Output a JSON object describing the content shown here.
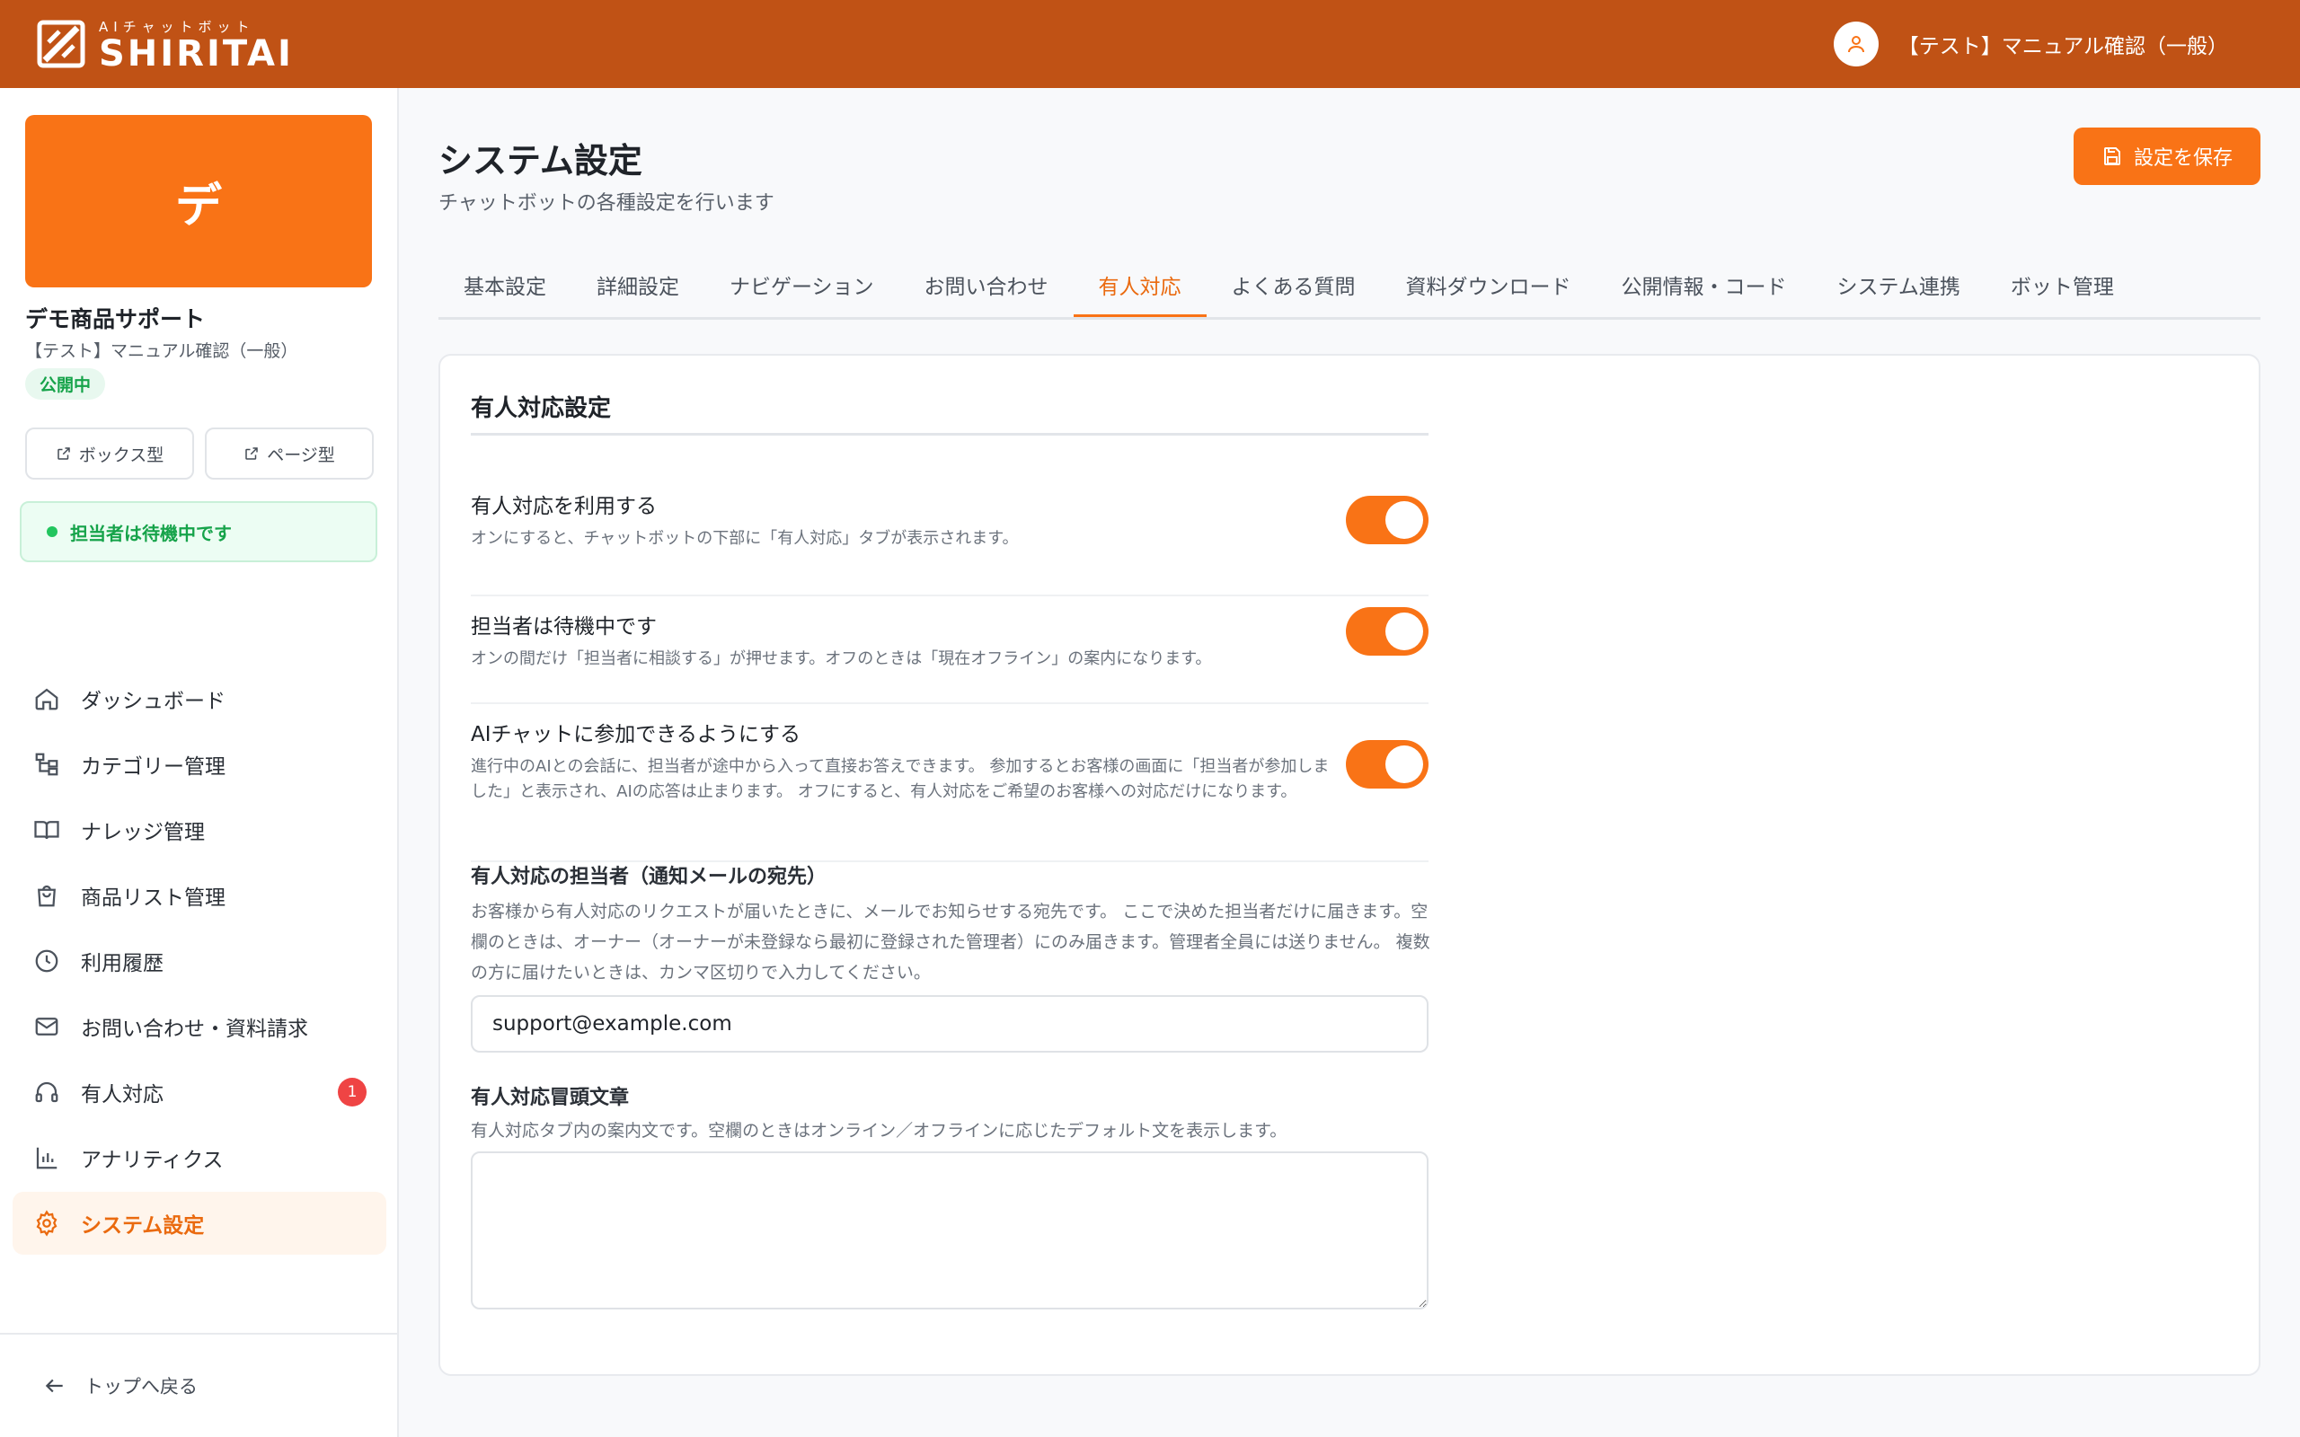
{
  "header": {
    "logo_sub": "AIチャットボット",
    "logo_main": "SHIRITAI",
    "user_name": "【テスト】マニュアル確認（一般）"
  },
  "sidebar": {
    "bot_initial": "デ",
    "bot_name": "デモ商品サポート",
    "bot_sub": "【テスト】マニュアル確認（一般）",
    "bot_status": "公開中",
    "box_type_label": "ボックス型",
    "page_type_label": "ページ型",
    "agent_status": "担当者は待機中です",
    "nav": [
      {
        "label": "ダッシュボード",
        "icon": "home-icon"
      },
      {
        "label": "カテゴリー管理",
        "icon": "category-tree-icon"
      },
      {
        "label": "ナレッジ管理",
        "icon": "book-icon"
      },
      {
        "label": "商品リスト管理",
        "icon": "shopping-bag-icon"
      },
      {
        "label": "利用履歴",
        "icon": "clock-icon"
      },
      {
        "label": "お問い合わせ・資料請求",
        "icon": "mail-icon"
      },
      {
        "label": "有人対応",
        "icon": "headphones-icon",
        "badge": "1"
      },
      {
        "label": "アナリティクス",
        "icon": "bar-chart-icon"
      },
      {
        "label": "システム設定",
        "icon": "gear-icon",
        "active": true
      }
    ],
    "back_label": "トップへ戻る"
  },
  "main": {
    "title": "システム設定",
    "description": "チャットボットの各種設定を行います",
    "save_label": "設定を保存",
    "tabs": [
      {
        "label": "基本設定"
      },
      {
        "label": "詳細設定"
      },
      {
        "label": "ナビゲーション"
      },
      {
        "label": "お問い合わせ"
      },
      {
        "label": "有人対応",
        "active": true
      },
      {
        "label": "よくある質問"
      },
      {
        "label": "資料ダウンロード"
      },
      {
        "label": "公開情報・コード"
      },
      {
        "label": "システム連携"
      },
      {
        "label": "ボット管理"
      }
    ],
    "card": {
      "title": "有人対応設定",
      "settings": [
        {
          "label": "有人対応を利用する",
          "desc": "オンにすると、チャットボットの下部に「有人対応」タブが表示されます。",
          "on": true
        },
        {
          "label": "担当者は待機中です",
          "desc": "オンの間だけ「担当者に相談する」が押せます。オフのときは「現在オフライン」の案内になります。",
          "on": true
        },
        {
          "label": "AIチャットに参加できるようにする",
          "desc": "進行中のAIとの会話に、担当者が途中から入って直接お答えできます。 参加するとお客様の画面に「担当者が参加しました」と表示され、AIの応答は止まります。 オフにすると、有人対応をご希望のお客様への対応だけになります。",
          "on": true
        }
      ],
      "recipient": {
        "label": "有人対応の担当者（通知メールの宛先）",
        "desc": "お客様から有人対応のリクエストが届いたときに、メールでお知らせする宛先です。 ここで決めた担当者だけに届きます。空欄のときは、オーナー（オーナーが未登録なら最初に登録された管理者）にのみ届きます。管理者全員には送りません。 複数の方に届けたいときは、カンマ区切りで入力してください。",
        "value": "support@example.com"
      },
      "intro": {
        "label": "有人対応冒頭文章",
        "desc": "有人対応タブ内の案内文です。空欄のときはオンライン／オフラインに応じたデフォルト文を表示します。",
        "value": ""
      }
    }
  },
  "colors": {
    "header": "#c05215",
    "accent": "#f97316",
    "success": "#16a34a",
    "badge": "#ef4444"
  }
}
